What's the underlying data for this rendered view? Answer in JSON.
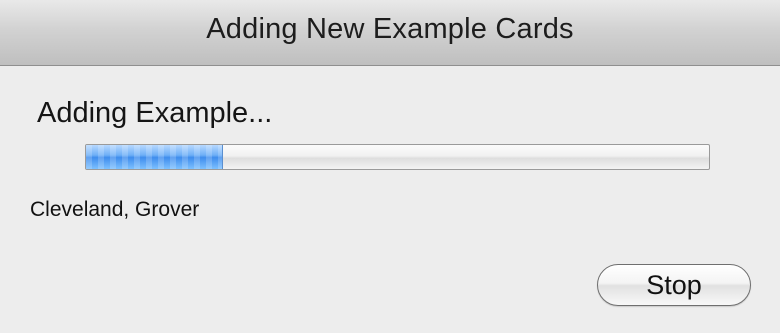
{
  "window": {
    "title": "Adding New Example Cards"
  },
  "dialog": {
    "heading": "Adding Example...",
    "progress_fraction": 0.22,
    "status_text": "Cleveland, Grover",
    "stop_label": "Stop"
  },
  "colors": {
    "progress_fill": "#4f98f1",
    "window_background": "#ececec"
  }
}
